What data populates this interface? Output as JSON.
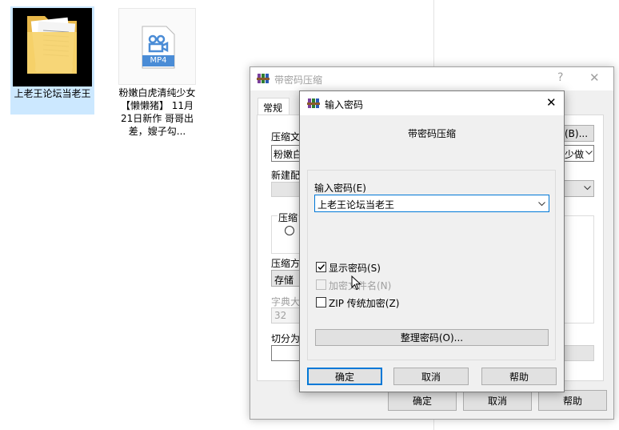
{
  "desktop": {
    "folder_label": "上老王论坛当老王",
    "mp4_badge": "MP4",
    "mp4_label": "粉嫩白虎清纯少女【懒懒猪】 11月21日新作 哥哥出差，嫂子勾..."
  },
  "back_dialog": {
    "title": "带密码压缩",
    "help_glyph": "?",
    "close_glyph": "✕",
    "tab_general": "常规",
    "label_archive": "压缩文",
    "archive_value": "粉嫩白",
    "browse_label": "(B)...",
    "right_combo_value": "少做",
    "label_new": "新建配",
    "label_compress_group": "压缩",
    "radio_partial": "",
    "label_method": "压缩方",
    "method_value": "存储",
    "label_dict": "字典大",
    "dict_value": "32",
    "label_split": "切分为",
    "ok": "确定",
    "cancel": "取消",
    "help": "帮助"
  },
  "front_dialog": {
    "title": "输入密码",
    "close_glyph": "✕",
    "heading": "带密码压缩",
    "password_label": "输入密码(E)",
    "password_value": "上老王论坛当老王",
    "show_password": "显示密码(S)",
    "encrypt_names": "加密文件名(N)",
    "zip_legacy": "ZIP 传统加密(Z)",
    "organize": "整理密码(O)...",
    "ok": "确定",
    "cancel": "取消",
    "help": "帮助"
  },
  "colors": {
    "accent": "#0078d7",
    "selection": "#cce8ff"
  }
}
